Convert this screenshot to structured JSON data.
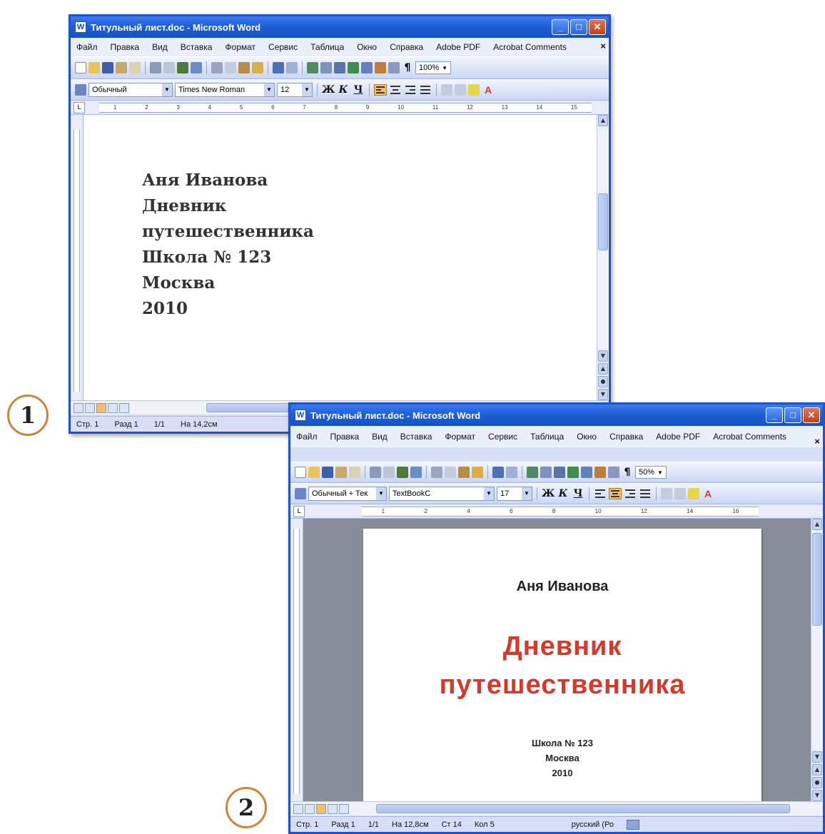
{
  "callouts": {
    "one": "1",
    "two": "2"
  },
  "window1": {
    "title": "Титульный лист.doc - Microsoft Word",
    "menu": [
      "Файл",
      "Правка",
      "Вид",
      "Вставка",
      "Формат",
      "Сервис",
      "Таблица",
      "Окно",
      "Справка",
      "Adobe PDF",
      "Acrobat Comments"
    ],
    "zoom": "100%",
    "style": "Обычный",
    "font": "Times New Roman",
    "font_size": "12",
    "ruler_numbers": [
      "1",
      "2",
      "3",
      "4",
      "5",
      "6",
      "7",
      "8",
      "9",
      "10",
      "11",
      "12",
      "13",
      "14",
      "15"
    ],
    "lines": [
      "Аня Иванова",
      "Дневник",
      "путешественника",
      "Школа № 123",
      "Москва",
      "2010"
    ],
    "status": {
      "page": "Стр. 1",
      "section": "Разд 1",
      "pages": "1/1",
      "position": "На 14,2см"
    }
  },
  "window2": {
    "title": "Титульный лист.doc - Microsoft Word",
    "menu": [
      "Файл",
      "Правка",
      "Вид",
      "Вставка",
      "Формат",
      "Сервис",
      "Таблица",
      "Окно",
      "Справка",
      "Adobe PDF",
      "Acrobat Comments"
    ],
    "zoom": "50%",
    "style": "Обычный + Тек",
    "font": "TextBookC",
    "font_size": "17",
    "ruler_numbers": [
      "1",
      "2",
      "4",
      "6",
      "8",
      "10",
      "12",
      "14",
      "16"
    ],
    "page": {
      "author": "Аня Иванова",
      "title_line1": "Дневник",
      "title_line2": "путешественника",
      "school": "Школа № 123",
      "city": "Москва",
      "year": "2010"
    },
    "status": {
      "page": "Стр. 1",
      "section": "Разд 1",
      "pages": "1/1",
      "position": "На 12,8см",
      "line": "Ст 14",
      "column": "Кол 5",
      "language": "русский (Ро"
    }
  },
  "colors": {
    "title_red": "#d23a2c",
    "xp_blue": "#1f5fd8"
  }
}
